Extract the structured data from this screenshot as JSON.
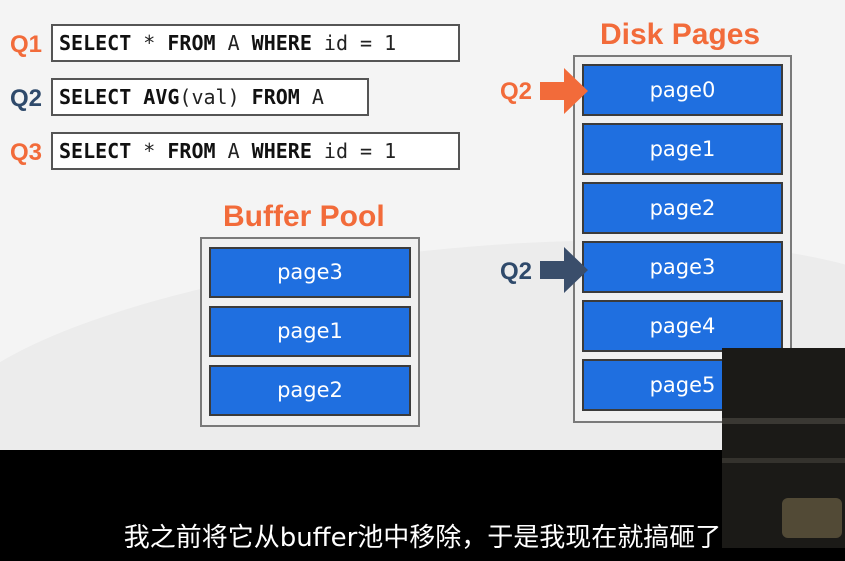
{
  "queries": [
    {
      "label": "Q1",
      "parts": [
        [
          "SELECT",
          true
        ],
        [
          " * ",
          false
        ],
        [
          "FROM",
          true
        ],
        [
          " A ",
          false
        ],
        [
          "WHERE",
          true
        ],
        [
          " id = 1",
          false
        ]
      ]
    },
    {
      "label": "Q2",
      "parts": [
        [
          "SELECT",
          true
        ],
        [
          " ",
          false
        ],
        [
          "AVG",
          true
        ],
        [
          "(val) ",
          false
        ],
        [
          "FROM",
          true
        ],
        [
          " A",
          false
        ]
      ]
    },
    {
      "label": "Q3",
      "parts": [
        [
          "SELECT",
          true
        ],
        [
          " * ",
          false
        ],
        [
          "FROM",
          true
        ],
        [
          " A ",
          false
        ],
        [
          "WHERE",
          true
        ],
        [
          " id = 1",
          false
        ]
      ]
    }
  ],
  "buffer_pool": {
    "title": "Buffer Pool",
    "pages": [
      "page3",
      "page1",
      "page2"
    ]
  },
  "disk_pages": {
    "title": "Disk Pages",
    "pages": [
      "page0",
      "page1",
      "page2",
      "page3",
      "page4",
      "page5"
    ]
  },
  "pointers": [
    {
      "label": "Q2",
      "target": "page0",
      "color": "#f26b3a"
    },
    {
      "label": "Q2",
      "target": "page3",
      "color": "#2f4a6b"
    }
  ],
  "colors": {
    "accent": "#f26b3a",
    "query_secondary": "#2f4a6b",
    "page_fill": "#1f6fe0"
  },
  "subtitle": "我之前将它从buffer池中移除，于是我现在就搞砸了"
}
